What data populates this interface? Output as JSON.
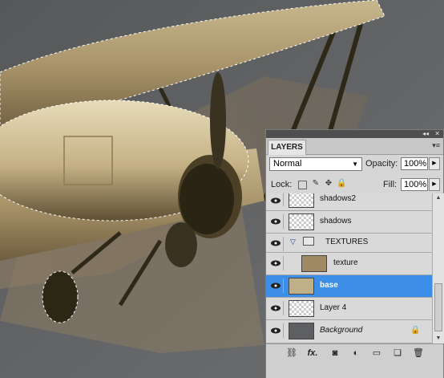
{
  "panel": {
    "tab_label": "LAYERS",
    "collapse_glyph": "◂◂",
    "close_glyph": "✕",
    "menu_glyph": "▾≡",
    "blend_mode": "Normal",
    "opacity_label": "Opacity:",
    "opacity_value": "100%",
    "lock_label": "Lock:",
    "fill_label": "Fill:",
    "fill_value": "100%"
  },
  "layers": [
    {
      "name": "shadows2",
      "type": "layer",
      "visible": true,
      "selected": false
    },
    {
      "name": "shadows",
      "type": "layer",
      "visible": true,
      "selected": false
    },
    {
      "name": "TEXTURES",
      "type": "group",
      "visible": true,
      "selected": false,
      "expanded": true
    },
    {
      "name": "texture",
      "type": "layer",
      "visible": true,
      "selected": false,
      "indented": true
    },
    {
      "name": "base",
      "type": "layer",
      "visible": true,
      "selected": true
    },
    {
      "name": "Layer 4",
      "type": "layer",
      "visible": true,
      "selected": false
    },
    {
      "name": "Background",
      "type": "background",
      "visible": true,
      "selected": false,
      "locked": true
    }
  ],
  "bottom_icons": [
    "link-icon",
    "fx-icon",
    "mask-icon",
    "adjustment-icon",
    "folder-icon",
    "new-layer-icon",
    "trash-icon"
  ],
  "bottom_glyphs": {
    "link": "⛓",
    "fx": "fx.",
    "mask": "◙",
    "adjust": "◐",
    "folder": "▭",
    "new": "❏",
    "trash": "🗑"
  },
  "colors": {
    "selection": "#3d8ee6",
    "canvas_bg": "#5f6062"
  }
}
